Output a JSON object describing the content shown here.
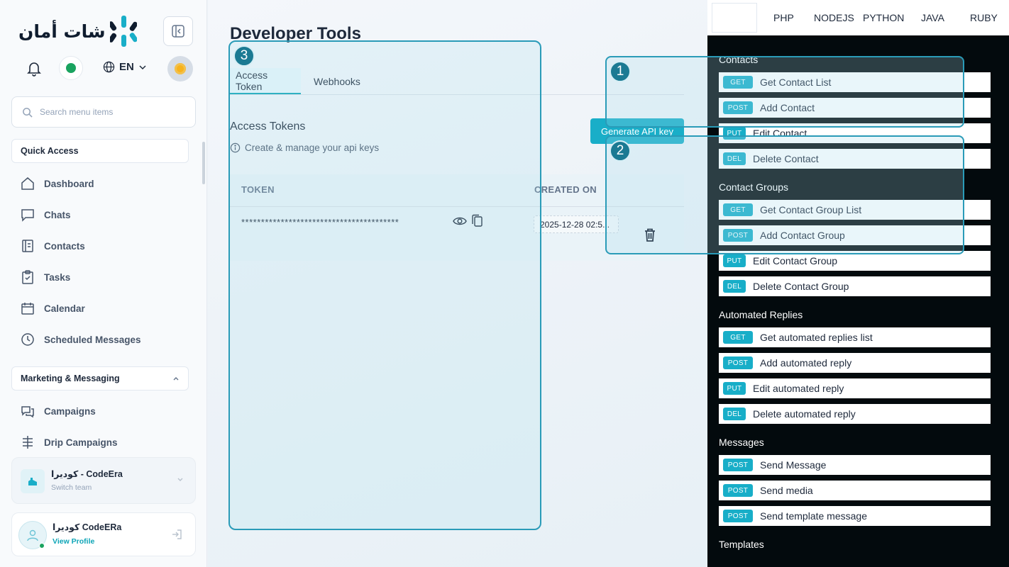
{
  "brand": {
    "logo_text": "شات أمان"
  },
  "header": {
    "language": "EN"
  },
  "search": {
    "placeholder": "Search menu items"
  },
  "sidebar": {
    "quick_access_title": "Quick Access",
    "quick_items": [
      {
        "label": "Dashboard",
        "icon": "home-icon"
      },
      {
        "label": "Chats",
        "icon": "chat-icon"
      },
      {
        "label": "Contacts",
        "icon": "contacts-icon"
      },
      {
        "label": "Tasks",
        "icon": "tasks-icon"
      },
      {
        "label": "Calendar",
        "icon": "calendar-icon"
      },
      {
        "label": "Scheduled Messages",
        "icon": "clock-icon"
      }
    ],
    "marketing_title": "Marketing & Messaging",
    "marketing_items": [
      {
        "label": "Campaigns",
        "icon": "campaigns-icon"
      },
      {
        "label": "Drip Campaigns",
        "icon": "drip-icon"
      }
    ],
    "team": {
      "name": "كوديرا - CodeEra",
      "sub": "Switch team"
    },
    "profile": {
      "name": "كوديرا CodeERa",
      "link": "View Profile"
    }
  },
  "main": {
    "title": "Developer Tools",
    "tabs": [
      {
        "label": "Access Token",
        "active": true
      },
      {
        "label": "Webhooks",
        "active": false
      }
    ],
    "card_title": "Access Tokens",
    "card_sub": "Create & manage your api keys",
    "generate_label": "Generate API key",
    "columns": {
      "token": "TOKEN",
      "created": "CREATED ON"
    },
    "rows": [
      {
        "token": "****************************************",
        "created": "2025-12-28 02:5..."
      }
    ]
  },
  "badges": {
    "one": "1",
    "two": "2",
    "three": "3"
  },
  "api": {
    "langs": [
      "PHP",
      "NODEJS",
      "PYTHON",
      "JAVA",
      "RUBY"
    ],
    "groups": [
      {
        "title": "Contacts",
        "endpoints": [
          {
            "method": "GET",
            "label": "Get Contact List"
          },
          {
            "method": "POST",
            "label": "Add Contact"
          },
          {
            "method": "PUT",
            "label": "Edit Contact"
          },
          {
            "method": "DEL",
            "label": "Delete Contact"
          }
        ]
      },
      {
        "title": "Contact Groups",
        "endpoints": [
          {
            "method": "GET",
            "label": "Get Contact Group List"
          },
          {
            "method": "POST",
            "label": "Add Contact Group"
          },
          {
            "method": "PUT",
            "label": "Edit Contact Group"
          },
          {
            "method": "DEL",
            "label": "Delete Contact Group"
          }
        ]
      },
      {
        "title": "Automated Replies",
        "endpoints": [
          {
            "method": "GET",
            "label": "Get automated replies list"
          },
          {
            "method": "POST",
            "label": "Add automated reply"
          },
          {
            "method": "PUT",
            "label": "Edit automated reply"
          },
          {
            "method": "DEL",
            "label": "Delete automated reply"
          }
        ]
      },
      {
        "title": "Messages",
        "endpoints": [
          {
            "method": "POST",
            "label": "Send Message"
          },
          {
            "method": "POST",
            "label": "Send media"
          },
          {
            "method": "POST",
            "label": "Send template message"
          }
        ]
      },
      {
        "title": "Templates",
        "endpoints": []
      }
    ]
  },
  "colors": {
    "accent": "#19aec8",
    "highlight": "#2a9bb8",
    "badge": "#1b7a93",
    "panel": "#030a0d",
    "online": "#1aa35f"
  }
}
